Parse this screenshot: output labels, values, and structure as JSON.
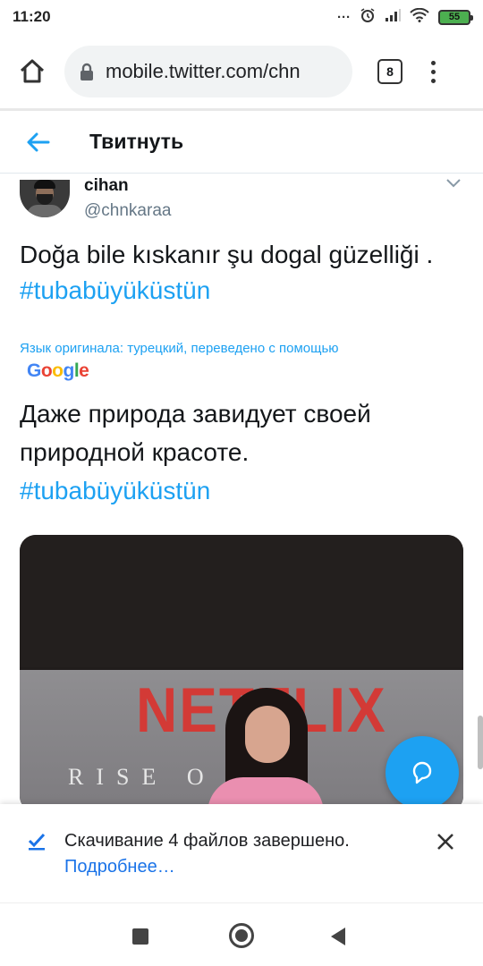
{
  "status_bar": {
    "time": "11:20",
    "battery": "55",
    "icons": [
      "dots-icon",
      "alarm-icon",
      "signal-icon",
      "signal-icon-2",
      "wifi-icon",
      "battery-icon"
    ]
  },
  "browser": {
    "url": "mobile.twitter.com/chn",
    "tab_count": "8"
  },
  "page": {
    "title": "Твитнуть"
  },
  "tweet": {
    "display_name": "cihan",
    "handle": "@chnkaraa",
    "text": "Doğa bile kıskanır şu dogal güzelliği . ",
    "hashtag": "#tubabüyüküstün",
    "translated_by": "Язык оригинала: турецкий, переведено с помощью",
    "translator": "Google",
    "translation_text": "Даже природа завидует своей природной красоте.",
    "translation_hashtag": "#tubabüyüküstün",
    "media": {
      "brand_text": "NETFLIX",
      "caption_text": "RISE O   PIR"
    }
  },
  "download": {
    "title": "Скачивание 4 файлов завершено.",
    "link": "Подробнее…"
  },
  "colors": {
    "accent": "#1da1f2",
    "link": "#1a73e8"
  }
}
